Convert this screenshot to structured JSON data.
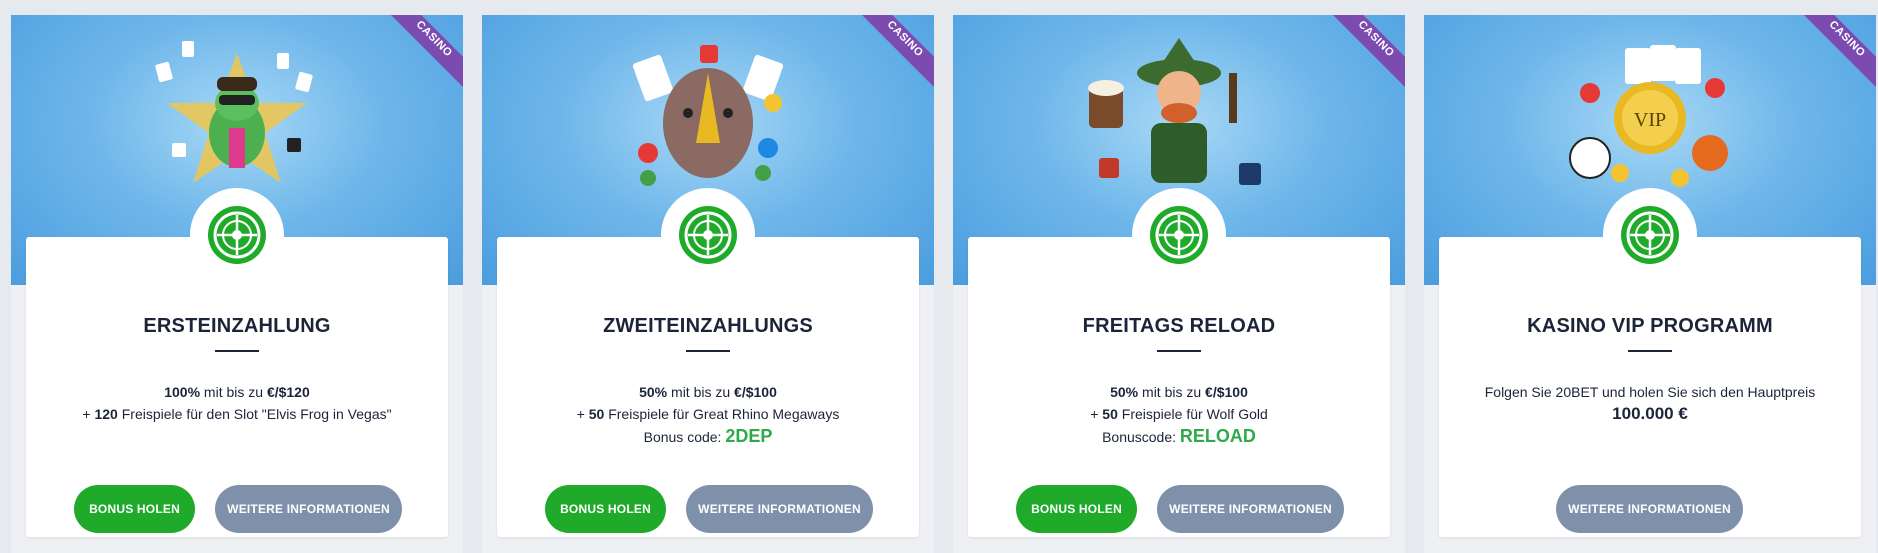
{
  "colors": {
    "accent_green": "#1faa2a",
    "button_grey": "#7f90aa",
    "ribbon_purple": "#7c4bb0",
    "code_green": "#2eaa4b",
    "title_dark": "#1b2438"
  },
  "cards": [
    {
      "ribbon": "CASINO",
      "art_icon": "frog-elvis-cards-dice",
      "logo_icon": "roulette-wheel-icon",
      "title": "ERSTEINZAHLUNG",
      "line1_bold": "100%",
      "line1_mid": " mit bis zu ",
      "line1_amount": "€/$120",
      "line2_prefix": "+ ",
      "line2_bold": "120",
      "line2_text": " Freispiele für den Slot \"Elvis Frog in Vegas\"",
      "bonus_btn": "BONUS HOLEN",
      "info_btn": "WEITERE INFORMATIONEN"
    },
    {
      "ribbon": "CASINO",
      "art_icon": "rhino-cards-chips",
      "logo_icon": "roulette-wheel-icon",
      "title": "ZWEITEINZAHLUNGS",
      "line1_bold": "50%",
      "line1_mid": " mit bis zu ",
      "line1_amount": "€/$100",
      "line2_prefix": "+ ",
      "line2_bold": "50",
      "line2_text": " Freispiele für Great Rhino Megaways",
      "code_label": "Bonus code: ",
      "code_value": "2DEP",
      "bonus_btn": "BONUS HOLEN",
      "info_btn": "WEITERE INFORMATIONEN"
    },
    {
      "ribbon": "CASINO",
      "art_icon": "leprechaun-mug-dice",
      "logo_icon": "roulette-wheel-icon",
      "title": "FREITAGS RELOAD",
      "line1_bold": "50%",
      "line1_mid": " mit bis zu ",
      "line1_amount": "€/$100",
      "line2_prefix": "+ ",
      "line2_bold": "50",
      "line2_text": " Freispiele für Wolf Gold",
      "code_label": "Bonuscode: ",
      "code_value": "RELOAD",
      "bonus_btn": "BONUS HOLEN",
      "info_btn": "WEITERE INFORMATIONEN"
    },
    {
      "ribbon": "CASINO",
      "art_icon": "vip-coin-cards-balls",
      "logo_icon": "roulette-wheel-icon",
      "title": "KASINO VIP PROGRAMM",
      "line1_text": "Folgen Sie 20BET und holen Sie sich den Hauptpreis",
      "prize": "100.000 €",
      "info_btn": "WEITERE INFORMATIONEN"
    }
  ]
}
